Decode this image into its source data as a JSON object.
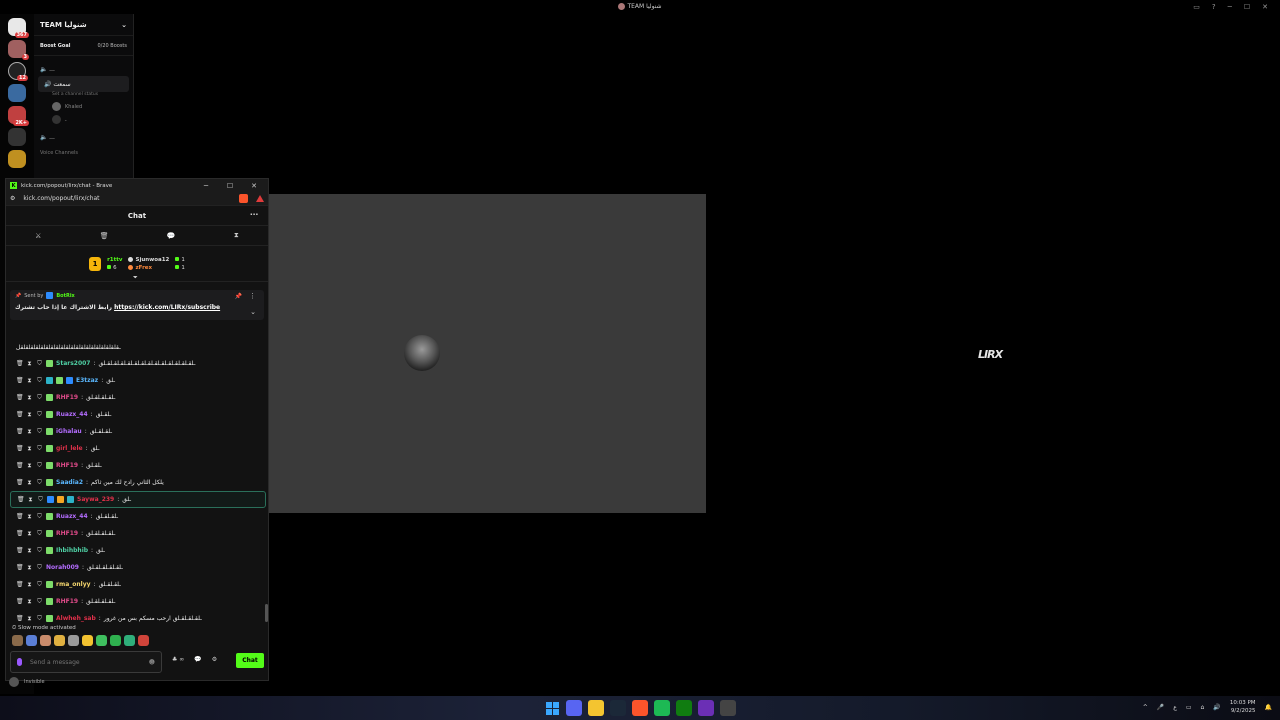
{
  "window": {
    "title": "TEAM شنوليا",
    "controls": [
      "▭",
      "?",
      "─",
      "☐",
      "✕"
    ]
  },
  "discord": {
    "server_name": "TEAM شنوليا",
    "server_badges": [
      "367",
      "3",
      "12",
      "",
      "2K+",
      ""
    ],
    "boost_goal_label": "Boost Goal",
    "boost_progress": "0/20 Boosts",
    "voice_channels": [
      "🔈  ـــ",
      "🔊  سمعت",
      "🔈  ـــ"
    ],
    "channel_status": "Set a channel status",
    "members": [
      "Khaled",
      "ـ"
    ],
    "category": "Voice Channels",
    "user_status": "Invisible"
  },
  "stage": {
    "brand_logo": "LIRX"
  },
  "browser": {
    "title": "kick.com/popout/lirx/chat - Brave",
    "url": "kick.com/popout/lirx/chat",
    "wc_min": "─",
    "wc_max": "☐",
    "wc_close": "✕"
  },
  "chat": {
    "title": "Chat",
    "more_icon": "⋯",
    "tools": [
      "⚔",
      "🗑",
      "💬",
      "⧗"
    ],
    "leaderboard": {
      "rank": "1",
      "top": {
        "name": "r1ttv",
        "count": "6"
      },
      "entries": [
        {
          "name": "Sjunwoa12",
          "count": "1"
        },
        {
          "name": "zFrex",
          "count": "1"
        }
      ],
      "expand_icon": "⏷"
    },
    "pinned": {
      "sent_by": "Sent by",
      "bot_name": "BotRix",
      "text": "رابط الاشتراك عا إذا حاب تشترك",
      "link": "https://kick.com/LIRx/subscribe",
      "pin_icon": "📌",
      "more_icon": "⋮",
      "chevron": "⌄"
    },
    "first_wrap": "ـقلقلقلقلقلقلقلقلقلقلقلقلقلقلقلقلقلقلقلقل",
    "messages": [
      {
        "user": "Stars2007",
        "color": "#4fd1a5",
        "text": "ـلقـلقـلقـلقـلقـلقـلقـلقـلقـلقـلقـلقـلقـلق",
        "badges": [
          "#7ddc6a"
        ]
      },
      {
        "user": "E3tzaz",
        "color": "#5ab8ff",
        "text": "ـلق",
        "badges": [
          "#2db3c8",
          "#7ddc6a",
          "#2d8cff"
        ]
      },
      {
        "user": "RHF19",
        "color": "#e14b8a",
        "text": "ـلقـلقـلقـلق",
        "badges": [
          "#7ddc6a"
        ]
      },
      {
        "user": "Ruazx_44",
        "color": "#b46dff",
        "text": "ـلقـلق",
        "badges": [
          "#7ddc6a"
        ]
      },
      {
        "user": "iGhalau",
        "color": "#b46dff",
        "text": "ـلقـلقـلق",
        "badges": [
          "#7ddc6a"
        ]
      },
      {
        "user": "girl_lele",
        "color": "#e0304a",
        "text": "ـلق",
        "badges": [
          "#7ddc6a"
        ]
      },
      {
        "user": "RHF19",
        "color": "#e14b8a",
        "text": "ـلقـلق",
        "badges": [
          "#7ddc6a"
        ]
      },
      {
        "user": "Saadia2",
        "color": "#5ab8ff",
        "text": "يلكل الثاني رادح لك مين ثاكم",
        "badges": [
          "#7ddc6a"
        ]
      },
      {
        "user": "Saywa_239",
        "color": "#e0304a",
        "text": "ـلق",
        "badges": [
          "#2d8cff",
          "#f5a623",
          "#2db3c8"
        ],
        "highlight": true
      },
      {
        "user": "Ruazx_44",
        "color": "#b46dff",
        "text": "ـلقـلقـلق",
        "badges": [
          "#7ddc6a"
        ]
      },
      {
        "user": "RHF19",
        "color": "#e14b8a",
        "text": "ـلقـلقـلقـلق",
        "badges": [
          "#7ddc6a"
        ]
      },
      {
        "user": "Ihbihbhib",
        "color": "#4fd1a5",
        "text": "ـلق",
        "badges": [
          "#7ddc6a"
        ]
      },
      {
        "user": "Norah009",
        "color": "#b46dff",
        "text": "ـلقـلقـلقـلقـلق",
        "badges": []
      },
      {
        "user": "rma_onlyy",
        "color": "#f5d76e",
        "text": "ـلقـلقـلق",
        "badges": [
          "#7ddc6a"
        ]
      },
      {
        "user": "RHF19",
        "color": "#e14b8a",
        "text": "ـلقـلقـلقـلق",
        "badges": [
          "#7ddc6a"
        ]
      },
      {
        "user": "Alwheh_sab",
        "color": "#e0304a",
        "text": "ـلقـلقـلقـلق ارحب مسكم بس من غرور",
        "badges": [
          "#7ddc6a"
        ]
      }
    ],
    "slow_mode": "Slow mode activated",
    "emote_colors": [
      "#8a6a4a",
      "#5b7fd6",
      "#c98b6b",
      "#e0b040",
      "#9a9a9a",
      "#f2c230",
      "#3fbf5f",
      "#2fb14f",
      "#2fae7a",
      "#d0443a"
    ],
    "placeholder": "Send a message",
    "composer_tools": [
      "♣ ∞",
      "💬",
      "⚙"
    ],
    "send_label": "Chat",
    "icon_mic": "mic-icon",
    "mod_icons": [
      "🗑",
      "⧗",
      "⛉"
    ]
  },
  "taskbar": {
    "apps": [
      "windows-icon",
      "discord-icon",
      "files-icon",
      "steam-icon",
      "brave-icon",
      "spotify-icon",
      "xbox-icon",
      "kick-icon",
      "obs-icon"
    ],
    "app_colors": [
      "",
      "#5865f2",
      "#f4c430",
      "#1b2838",
      "#fb542b",
      "#1db954",
      "#107c10",
      "#6b2fb5",
      "#444"
    ],
    "tray": [
      "^",
      "🎤",
      "ع",
      "▭",
      "⌂",
      "🔊"
    ],
    "time": "10:03 PM",
    "date": "9/2/2025"
  }
}
